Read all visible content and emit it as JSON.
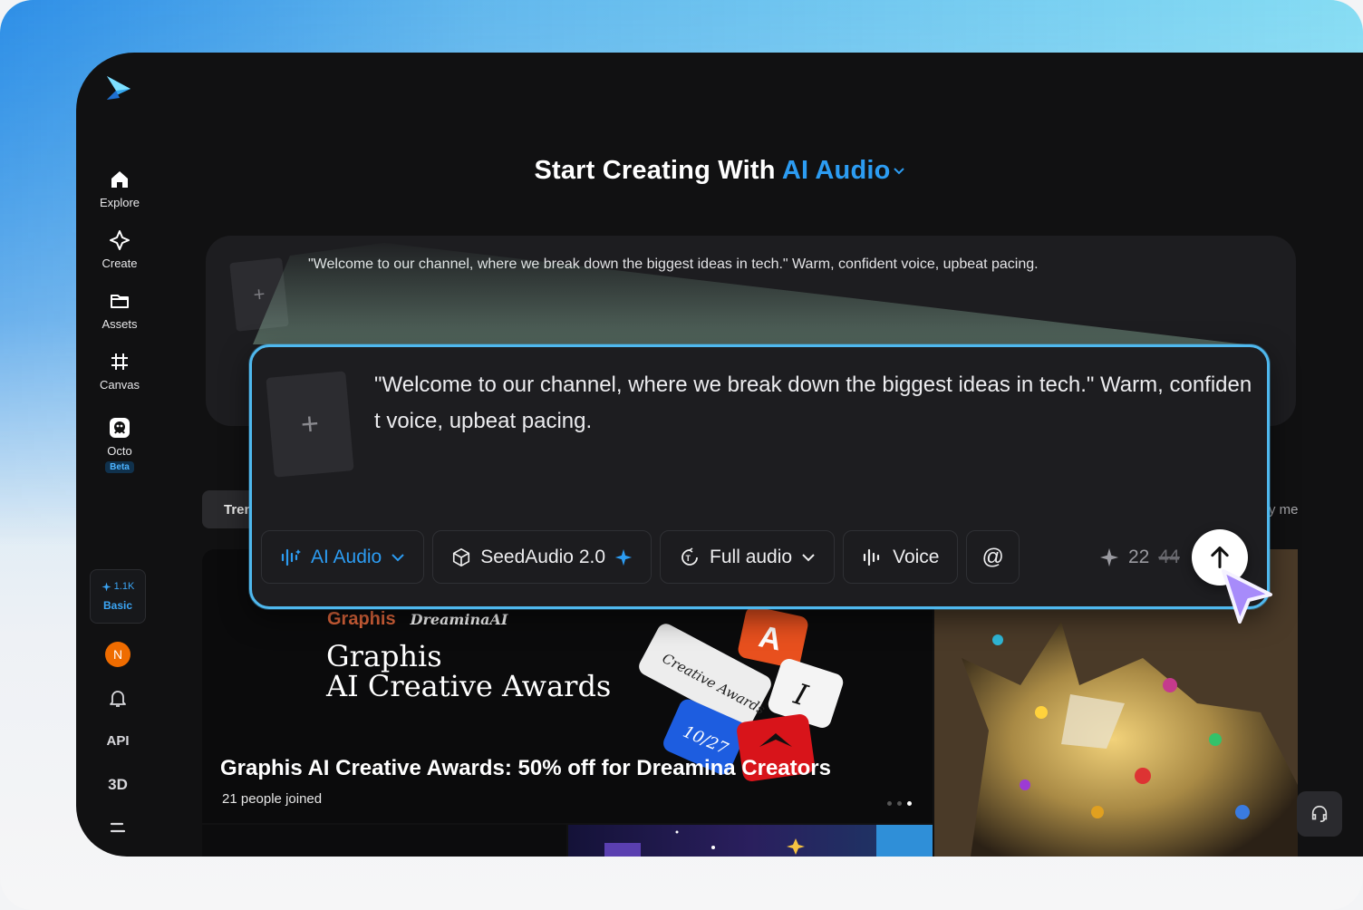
{
  "colors": {
    "accent": "#2c9cf2",
    "frame": "#4fb8ee",
    "avatar": "#ef6c00"
  },
  "sidebar": {
    "logo_icon": "dreamina-logo-icon",
    "items": [
      {
        "label": "Explore",
        "icon": "home-icon"
      },
      {
        "label": "Create",
        "icon": "sparkle-diamond-icon"
      },
      {
        "label": "Assets",
        "icon": "folder-icon"
      },
      {
        "label": "Canvas",
        "icon": "canvas-grid-icon"
      },
      {
        "label": "Octo",
        "icon": "octo-icon",
        "badge": "Beta"
      }
    ],
    "credits": {
      "count": "1.1K",
      "plan": "Basic"
    },
    "avatar_initial": "N",
    "api_label": "API",
    "three_d_label": "3D"
  },
  "header": {
    "title_prefix": "Start Creating With",
    "title_mode": "AI Audio"
  },
  "prompt_bg": {
    "text": "\"Welcome to our channel, where we break down the biggest ideas in tech.\" Warm, confident voice, upbeat pacing."
  },
  "tabs": {
    "trending": "Trending",
    "right_hint": "y me"
  },
  "featured": {
    "brand_left": "Graphis",
    "brand_right": "DreaminaAI",
    "heading_line1": "Graphis",
    "heading_line2": "AI Creative Awards",
    "keycap_text": "Creative Awards",
    "keycap_date": "10/27",
    "keycap_a": "A",
    "keycap_i": "I",
    "caption": "Graphis AI Creative Awards: 50% off for Dreamina Creators",
    "joined_count": "21",
    "joined_label": "people joined"
  },
  "composer": {
    "text": "\"Welcome to our channel, where we break down the biggest ideas in tech.\" Warm, confident voice, upbeat pacing.",
    "mode": "AI Audio",
    "model": "SeedAudio 2.0",
    "length": "Full audio",
    "voice": "Voice",
    "mention": "@",
    "cost": "22",
    "cost_original": "44"
  }
}
